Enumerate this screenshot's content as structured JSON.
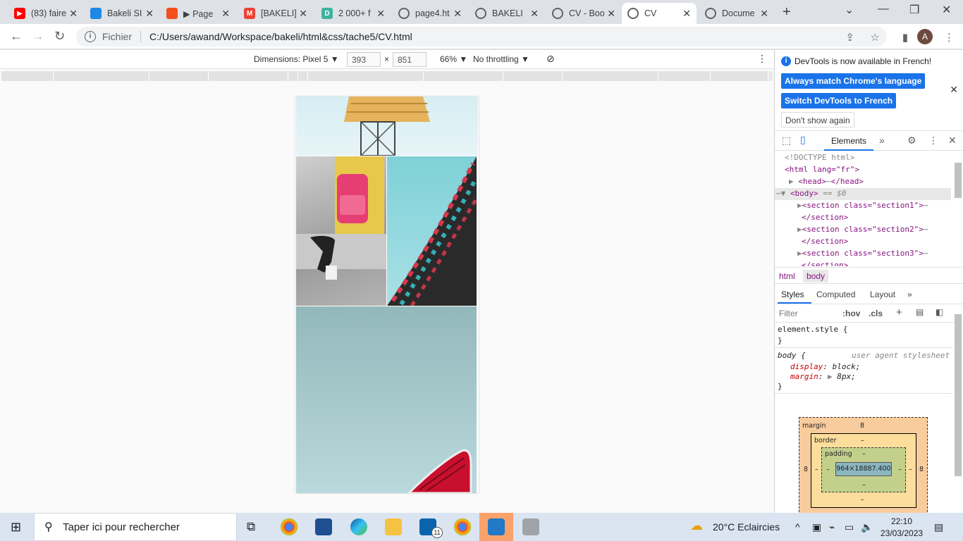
{
  "browser": {
    "tabs": [
      {
        "title": "(83) faire",
        "favicon": "youtube-icon",
        "color": "#ff0000"
      },
      {
        "title": "Bakeli SI",
        "favicon": "bakeli-icon",
        "color": "#1e88e5"
      },
      {
        "title": "▶ Page",
        "favicon": "figma-icon",
        "color": "#f24e1e"
      },
      {
        "title": "[BAKELI]",
        "favicon": "gmail-icon",
        "color": "#ea4335"
      },
      {
        "title": "2 000+ f",
        "favicon": "d-icon",
        "color": "#3db39e"
      },
      {
        "title": "page4.ht",
        "favicon": "globe-icon",
        "color": "#5f6368"
      },
      {
        "title": "BAKELI",
        "favicon": "globe-icon",
        "color": "#5f6368"
      },
      {
        "title": "CV - Boo",
        "favicon": "globe-icon",
        "color": "#5f6368"
      },
      {
        "title": "CV",
        "favicon": "globe-icon",
        "color": "#5f6368",
        "active": true
      },
      {
        "title": "Docume",
        "favicon": "globe-icon",
        "color": "#5f6368"
      }
    ],
    "address": {
      "scheme_label": "Fichier",
      "url": "C:/Users/awand/Workspace/bakeli/html&css/tache5/CV.html"
    },
    "profile_initial": "A"
  },
  "device_toolbar": {
    "dimensions_label": "Dimensions: Pixel 5 ▼",
    "width": "393",
    "height": "851",
    "times": "×",
    "zoom": "66% ▼",
    "throttling": "No throttling ▼"
  },
  "devtools": {
    "banner": {
      "message": "DevTools is now available in French!",
      "btn_match": "Always match Chrome's language",
      "btn_switch": "Switch DevTools to French",
      "btn_dont": "Don't show again"
    },
    "tabs": {
      "elements": "Elements"
    },
    "dom": {
      "doctype": "<!DOCTYPE html>",
      "html_open": "<html lang=\"fr\">",
      "head": "<head>",
      "head_close": "</head>",
      "body": "<body>",
      "body_eq": "== $0",
      "sections": [
        {
          "open": "<section class=\"section1\">",
          "close": "</section>"
        },
        {
          "open": "<section class=\"section2\">",
          "close": "</section>"
        },
        {
          "open": "<section class=\"section3\">",
          "close": "</section>"
        }
      ]
    },
    "breadcrumbs": [
      "html",
      "body"
    ],
    "subtabs": [
      "Styles",
      "Computed",
      "Layout"
    ],
    "filter_placeholder": "Filter",
    "hov": ":hov",
    "cls": ".cls",
    "styles": {
      "element_style": "element.style {",
      "close_brace": "}",
      "body_selector": "body {",
      "ua_label": "user agent stylesheet",
      "prop1": "display",
      "val1": "block;",
      "prop2": "margin",
      "val2": "8px;"
    },
    "boxmodel": {
      "margin_label": "margin",
      "margin_value": "8",
      "border_label": "border",
      "padding_label": "padding",
      "dash": "–",
      "content": "964×18887.400",
      "side": "8"
    }
  },
  "taskbar": {
    "search_placeholder": "Taper ici pour rechercher",
    "weather": "20°C  Eclaircies",
    "time": "22:10",
    "date": "23/03/2023",
    "mail_badge": "11"
  }
}
